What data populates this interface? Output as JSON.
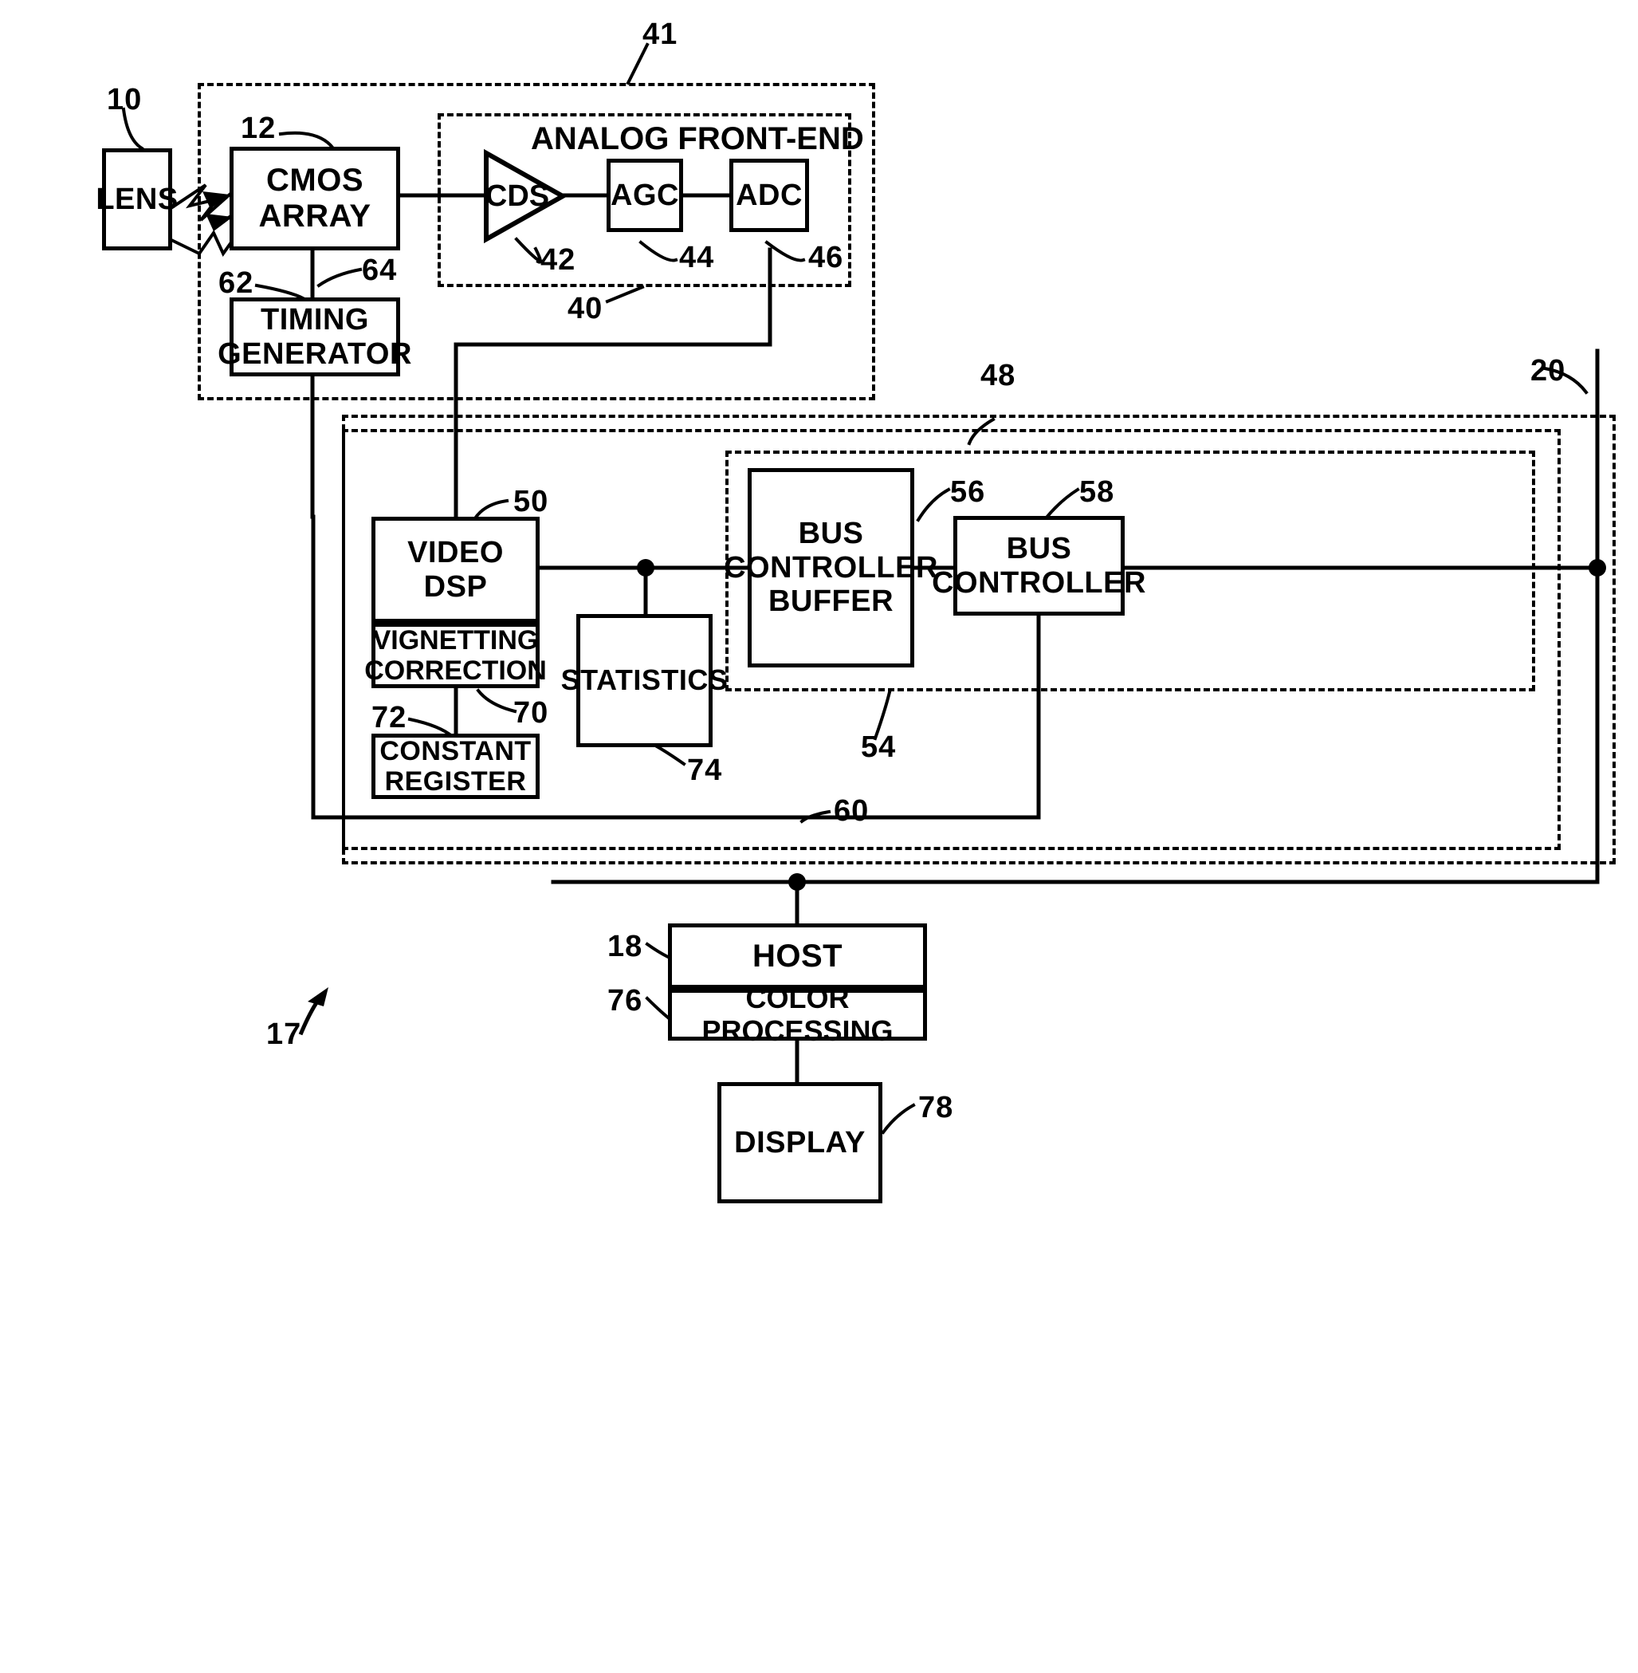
{
  "figure": {
    "type": "patent-block-diagram",
    "title_caption": "ANALOG FRONT-END"
  },
  "blocks": {
    "lens": {
      "label": "LENS",
      "ref": "10"
    },
    "cmos_array": {
      "label": "CMOS\nARRAY",
      "ref": "12"
    },
    "cds": {
      "label": "CDS",
      "ref": "42"
    },
    "agc": {
      "label": "AGC",
      "ref": "44"
    },
    "adc": {
      "label": "ADC",
      "ref": "46"
    },
    "timing_generator": {
      "label": "TIMING\nGENERATOR",
      "ref": "62"
    },
    "video_dsp": {
      "label": "VIDEO\nDSP",
      "ref": "50"
    },
    "vignetting_correction": {
      "label": "VIGNETTING\nCORRECTION",
      "ref": "70"
    },
    "constant_register": {
      "label": "CONSTANT\nREGISTER",
      "ref": "72"
    },
    "statistics": {
      "label": "STATISTICS",
      "ref": "74"
    },
    "bus_controller_buffer": {
      "label": "BUS\nCONTROLLER\nBUFFER",
      "ref": "56"
    },
    "bus_controller": {
      "label": "BUS\nCONTROLLER",
      "ref": "58"
    },
    "host": {
      "label": "HOST",
      "ref": "18"
    },
    "color_processing": {
      "label": "COLOR PROCESSING",
      "ref": "76"
    },
    "display": {
      "label": "DISPLAY",
      "ref": "78"
    }
  },
  "enclosures": {
    "sensor_module": {
      "ref": "41"
    },
    "analog_front_end": {
      "label": "ANALOG FRONT-END",
      "ref": "40"
    },
    "processor_outer": {
      "ref": "20"
    },
    "processor_inner": {
      "ref": "48"
    },
    "bus_group": {
      "ref": "54"
    }
  },
  "connections": {
    "clock_line": {
      "ref": "64"
    },
    "feedback_line": {
      "ref": "60"
    }
  },
  "figure_ref": {
    "ref": "17"
  },
  "refs": {
    "r10": "10",
    "r12": "12",
    "r17": "17",
    "r18": "18",
    "r20": "20",
    "r40": "40",
    "r41": "41",
    "r42": "42",
    "r44": "44",
    "r46": "46",
    "r48": "48",
    "r50": "50",
    "r54": "54",
    "r56": "56",
    "r58": "58",
    "r60": "60",
    "r62": "62",
    "r64": "64",
    "r70": "70",
    "r72": "72",
    "r74": "74",
    "r76": "76",
    "r78": "78"
  },
  "colors": {
    "ink": "#000000",
    "paper": "#ffffff"
  }
}
